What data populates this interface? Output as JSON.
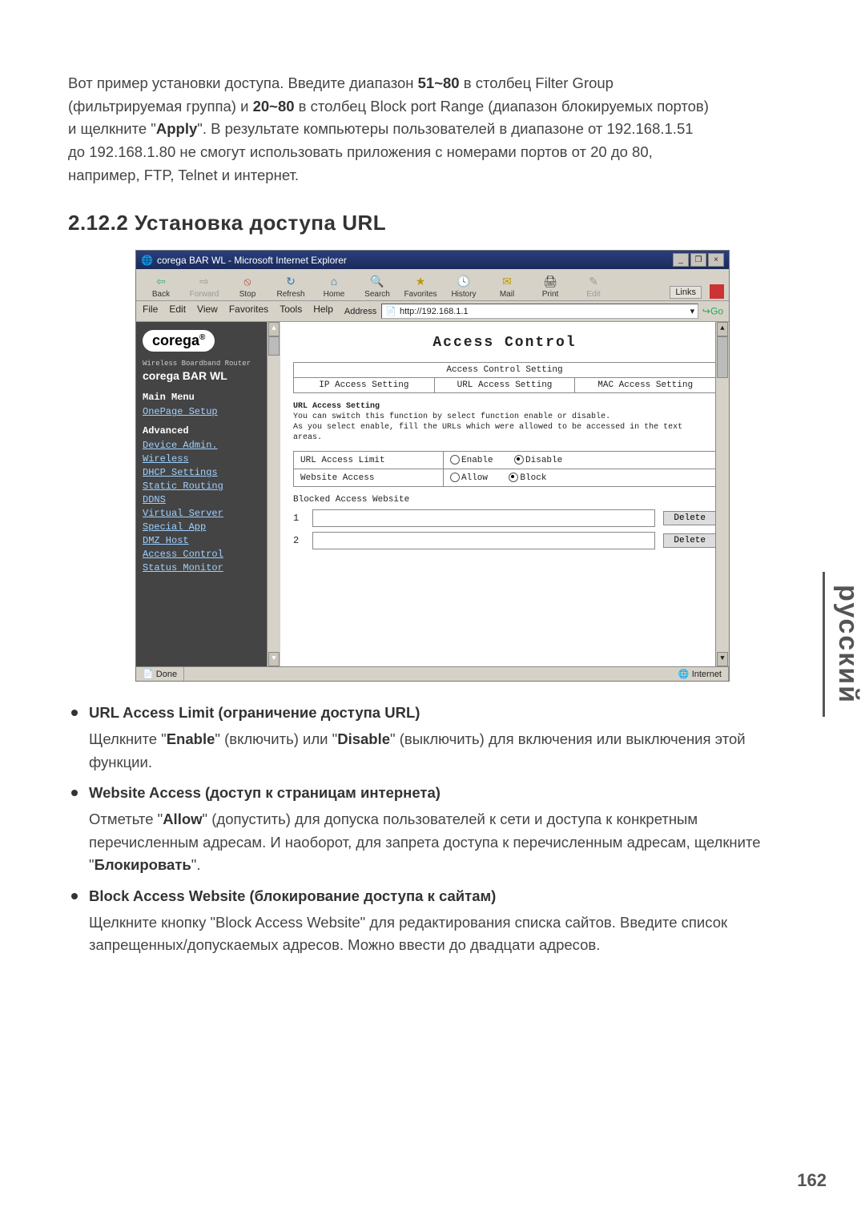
{
  "intro": {
    "line1_a": "Вот пример установки доступа. Введите диапазон ",
    "range1": "51~80",
    "line1_b": " в столбец Filter Group",
    "line2_a": "(фильтрируемая группа) и ",
    "range2": "20~80",
    "line2_b": " в столбец Block port Range (диапазон блокируемых портов)",
    "line3_a": "и щелкните \"",
    "apply": "Apply",
    "line3_b": "\". В результате компьютеры пользователей в диапазоне от 192.168.1.51",
    "line4": "до 192.168.1.80 не смогут использовать приложения с номерами портов от 20 до 80,",
    "line5": "например, FTP, Telnet и интернет."
  },
  "section_heading": "2.12.2 Установка доступа URL",
  "shot": {
    "title": "corega BAR WL - Microsoft Internet Explorer",
    "toolbar": {
      "back": "Back",
      "forward": "Forward",
      "stop": "Stop",
      "refresh": "Refresh",
      "home": "Home",
      "search": "Search",
      "favorites": "Favorites",
      "history": "History",
      "mail": "Mail",
      "print": "Print",
      "edit": "Edit",
      "links": "Links"
    },
    "menus": [
      "File",
      "Edit",
      "View",
      "Favorites",
      "Tools",
      "Help"
    ],
    "address_label": "Address",
    "address_value": "http://192.168.1.1",
    "go": "Go",
    "sidebar": {
      "logo": "corega",
      "subbrand": "Wireless Boardband Router",
      "model": "corega  BAR WL",
      "main_menu": "Main Menu",
      "onepage": "OnePage Setup",
      "advanced": "Advanced",
      "items": [
        "Device Admin.",
        "Wireless",
        "DHCP Settings",
        "Static Routing",
        "DDNS",
        "Virtual Server",
        "Special App",
        "DMZ Host",
        "Access Control",
        "Status Monitor"
      ]
    },
    "content": {
      "heading": "Access Control",
      "setting_title": "Access Control Setting",
      "tabs": [
        "IP Access Setting",
        "URL Access Setting",
        "MAC Access Setting"
      ],
      "para_title": "URL Access Setting",
      "para_l1": "You can switch this function by select function enable or disable.",
      "para_l2": "As you select enable, fill the URLs which were allowed to be accessed in the text areas.",
      "row1_label": "URL Access Limit",
      "row1_opts": [
        "Enable",
        "Disable"
      ],
      "row2_label": "Website Access",
      "row2_opts": [
        "Allow",
        "Block"
      ],
      "blocked_label": "Blocked Access Website",
      "entries": [
        "1",
        "2"
      ],
      "delete": "Delete"
    },
    "status_done": "Done",
    "status_zone": "Internet"
  },
  "bullets": [
    {
      "title": "URL Access Limit (ограничение доступа URL)",
      "body_a": "Щелкните \"",
      "b1": "Enable",
      "body_b": "\" (включить) или  \"",
      "b2": "Disable",
      "body_c": "\" (выключить) для включения или выключения этой функции."
    },
    {
      "title": "Website Access (доступ к страницам интернета)",
      "body_a": "Отметьте \"",
      "b1": "Allow",
      "body_b": "\" (допустить) для допуска пользователей к сети и доступа к конкретным перечисленным адресам. И наоборот, для запрета доступа к перечисленным адресам, щелкните \"",
      "b2": "Блокировать",
      "body_c": "\"."
    },
    {
      "title": "Block Access Website (блокирование доступа к сайтам)",
      "body": "Щелкните кнопку \"Block Access Website\" для редактирования списка сайтов. Введите список запрещенных/допускаемых адресов. Можно ввести до двадцати адресов."
    }
  ],
  "side_tab": "русский",
  "page_number": "162"
}
